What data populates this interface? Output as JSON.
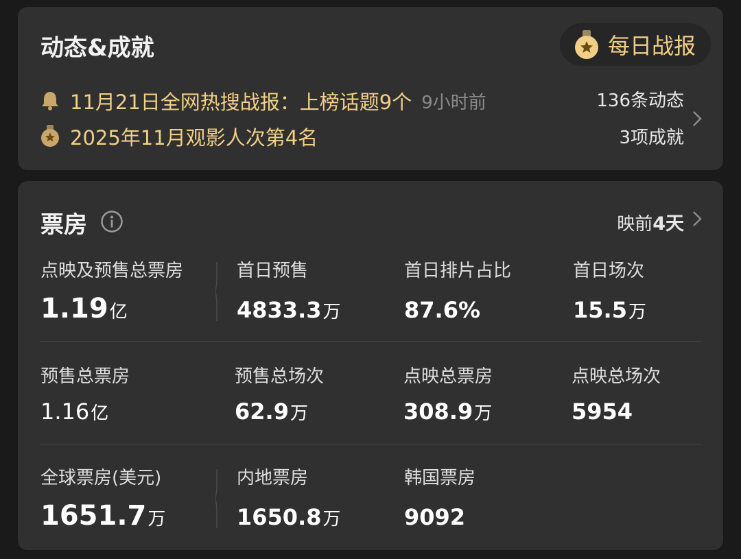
{
  "achievements": {
    "title": "动态&成就",
    "daily_button_label": "每日战报",
    "news": [
      {
        "text": "11月21日全网热搜战报：上榜话题9个",
        "time": "9小时前",
        "icon": "bell-icon"
      },
      {
        "text": "2025年11月观影人次第4名",
        "time": "",
        "icon": "medal-icon"
      }
    ],
    "counts": {
      "updates": "136条动态",
      "achievements": "3项成就"
    }
  },
  "box_office": {
    "title": "票房",
    "release_prefix": "映前",
    "release_days": "4天",
    "rows": [
      [
        {
          "label": "点映及预售总票房",
          "value": "1.19",
          "unit": "亿"
        },
        {
          "label": "首日预售",
          "value": "4833.3",
          "unit": "万"
        },
        {
          "label": "首日排片占比",
          "value": "87.6%",
          "unit": ""
        },
        {
          "label": "首日场次",
          "value": "15.5",
          "unit": "万"
        }
      ],
      [
        {
          "label": "预售总票房",
          "value": "1.16",
          "unit": "亿"
        },
        {
          "label": "预售总场次",
          "value": "62.9",
          "unit": "万"
        },
        {
          "label": "点映总票房",
          "value": "308.9",
          "unit": "万"
        },
        {
          "label": "点映总场次",
          "value": "5954",
          "unit": ""
        }
      ],
      [
        {
          "label": "全球票房(美元)",
          "value": "1651.7",
          "unit": "万"
        },
        {
          "label": "内地票房",
          "value": "1650.8",
          "unit": "万"
        },
        {
          "label": "韩国票房",
          "value": "9092",
          "unit": ""
        }
      ]
    ]
  },
  "colors": {
    "accent_gold": "#f1cf86",
    "card_bg": "#303030",
    "page_bg": "#1a1a1a"
  }
}
